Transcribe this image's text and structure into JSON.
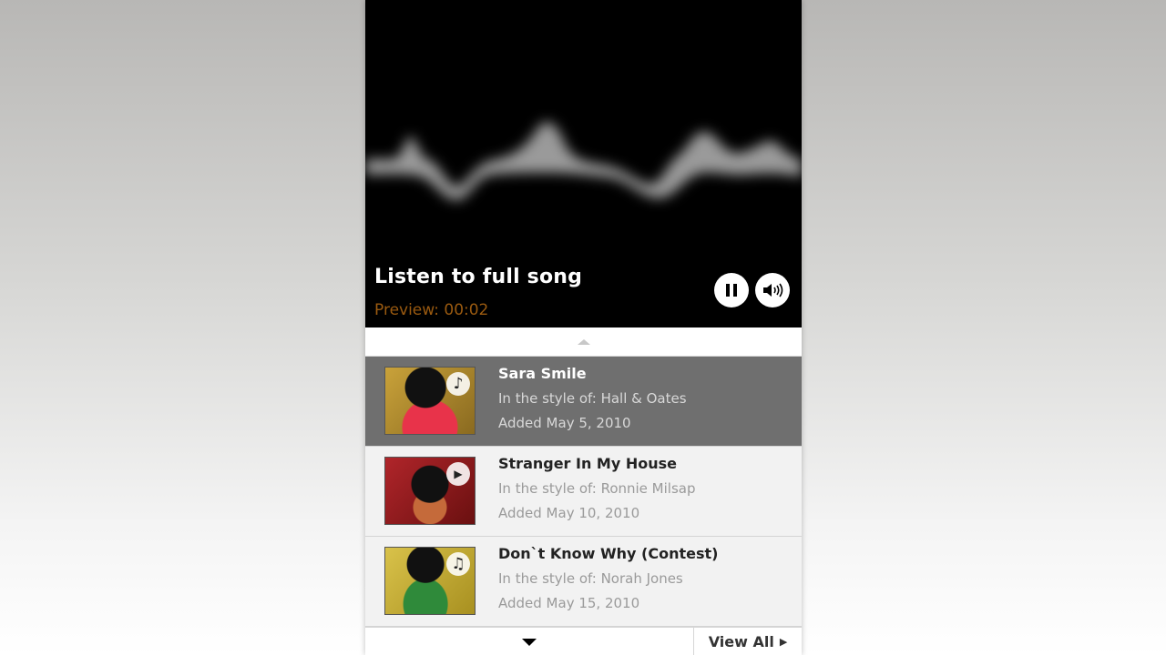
{
  "player": {
    "title": "Listen to full song",
    "preview_label": "Preview: 00:02",
    "pause_icon": "pause-icon",
    "volume_icon": "volume-icon"
  },
  "list": {
    "items": [
      {
        "title": "Sara Smile",
        "style": "In the style of: Hall & Oates",
        "date": "Added May 5, 2010",
        "badge": "♪",
        "badge_icon": "music-note-icon",
        "selected": true
      },
      {
        "title": "Stranger In My House",
        "style": "In the style of: Ronnie Milsap",
        "date": "Added May 10, 2010",
        "badge": "▶",
        "badge_icon": "video-camera-icon",
        "selected": false
      },
      {
        "title": "Don`t Know Why (Contest)",
        "style": "In the style of: Norah Jones",
        "date": "Added May 15, 2010",
        "badge": "♫",
        "badge_icon": "music-notes-icon",
        "selected": false
      }
    ]
  },
  "footer": {
    "view_all_label": "View All"
  },
  "colors": {
    "preview_text": "#9a5a10",
    "selected_row": "#6f6f6f"
  }
}
